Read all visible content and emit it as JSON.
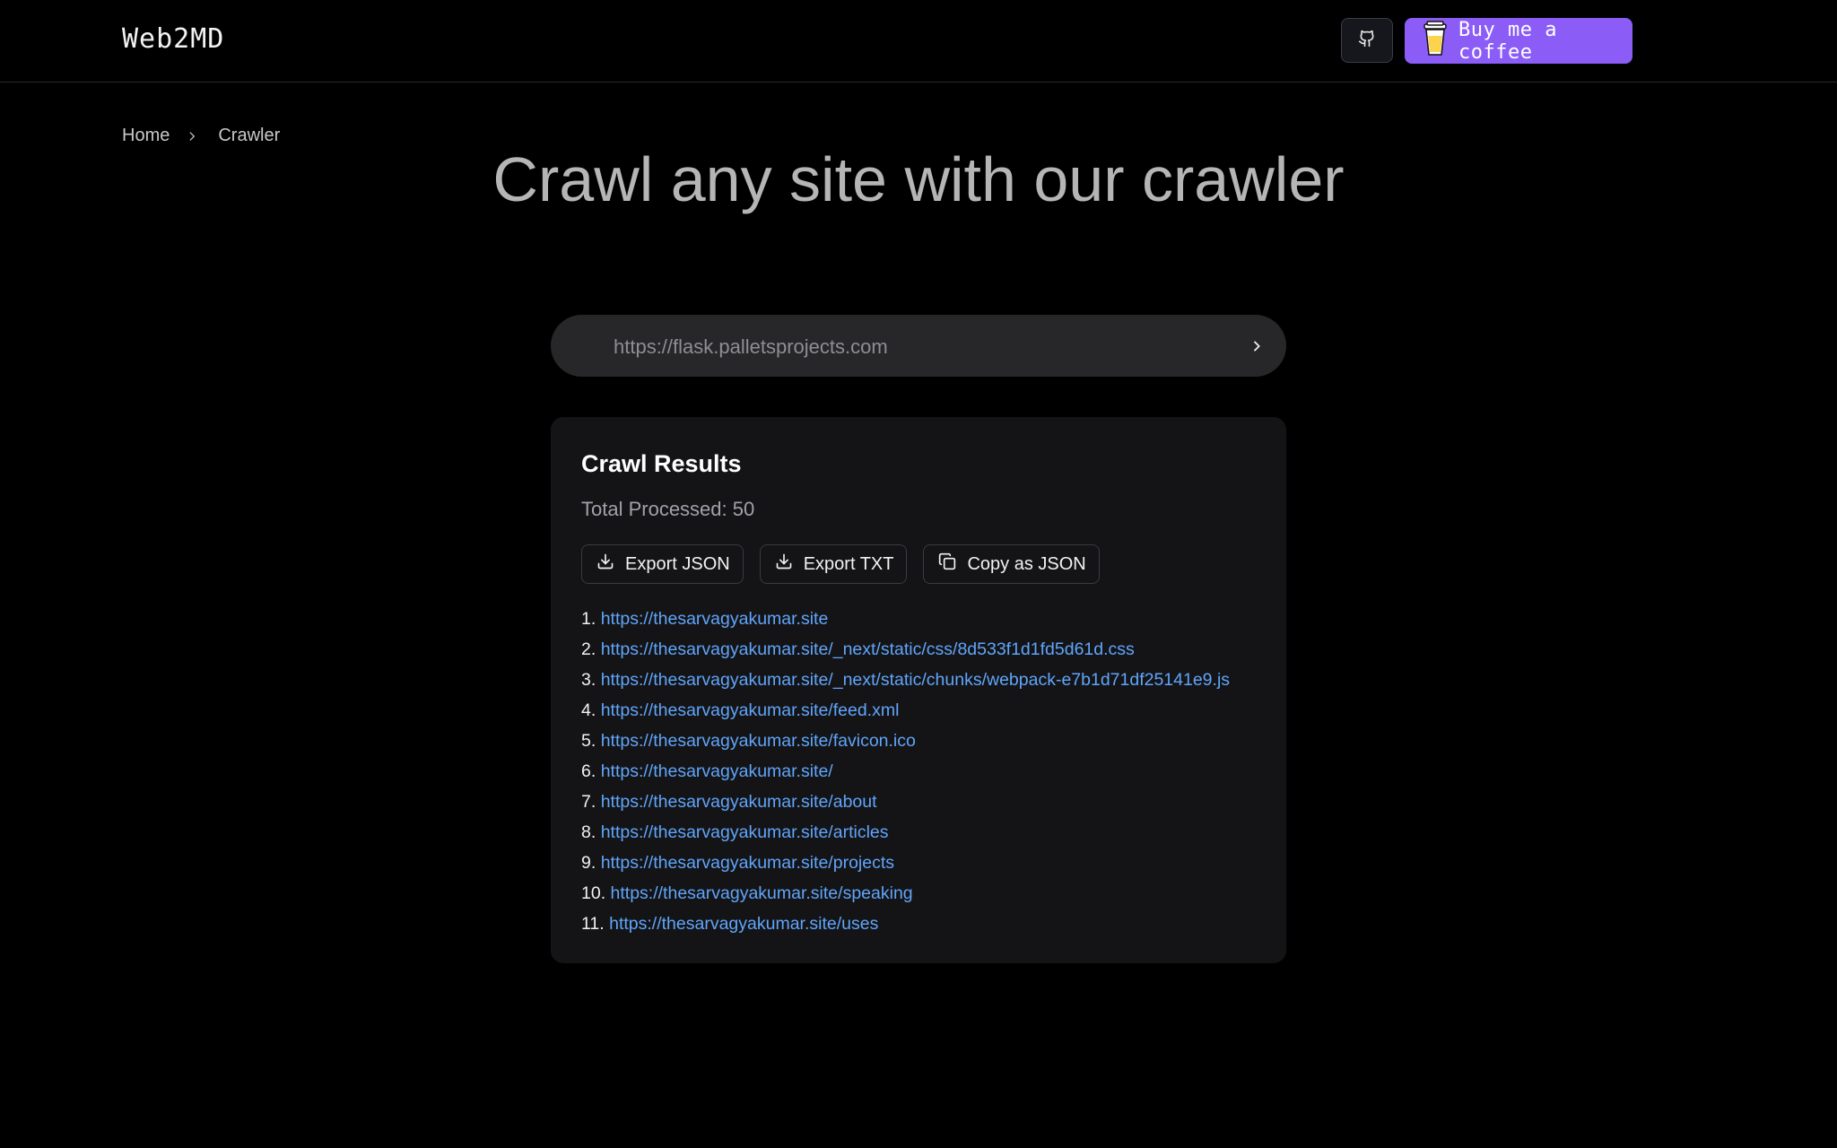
{
  "header": {
    "logo": "Web2MD",
    "github_icon": "github-icon",
    "coffee_label": "Buy me a coffee",
    "coffee_icon": "coffee-cup-icon",
    "accent_color": "#8b5cf6"
  },
  "breadcrumb": {
    "items": [
      "Home",
      "Crawler"
    ]
  },
  "hero": {
    "title": "Crawl any site with our crawler"
  },
  "search": {
    "placeholder": "https://flask.palletsprojects.com",
    "value": ""
  },
  "results": {
    "title": "Crawl Results",
    "total_label": "Total Processed: 50",
    "actions": {
      "export_json": "Export JSON",
      "export_txt": "Export TXT",
      "copy_json": "Copy as JSON"
    },
    "link_color": "#60a5fa",
    "items": [
      {
        "num": "1.",
        "url": "https://thesarvagyakumar.site"
      },
      {
        "num": "2.",
        "url": "https://thesarvagyakumar.site/_next/static/css/8d533f1d1fd5d61d.css"
      },
      {
        "num": "3.",
        "url": "https://thesarvagyakumar.site/_next/static/chunks/webpack-e7b1d71df25141e9.js"
      },
      {
        "num": "4.",
        "url": "https://thesarvagyakumar.site/feed.xml"
      },
      {
        "num": "5.",
        "url": "https://thesarvagyakumar.site/favicon.ico"
      },
      {
        "num": "6.",
        "url": "https://thesarvagyakumar.site/"
      },
      {
        "num": "7.",
        "url": "https://thesarvagyakumar.site/about"
      },
      {
        "num": "8.",
        "url": "https://thesarvagyakumar.site/articles"
      },
      {
        "num": "9.",
        "url": "https://thesarvagyakumar.site/projects"
      },
      {
        "num": "10.",
        "url": "https://thesarvagyakumar.site/speaking"
      },
      {
        "num": "11.",
        "url": "https://thesarvagyakumar.site/uses"
      }
    ]
  }
}
